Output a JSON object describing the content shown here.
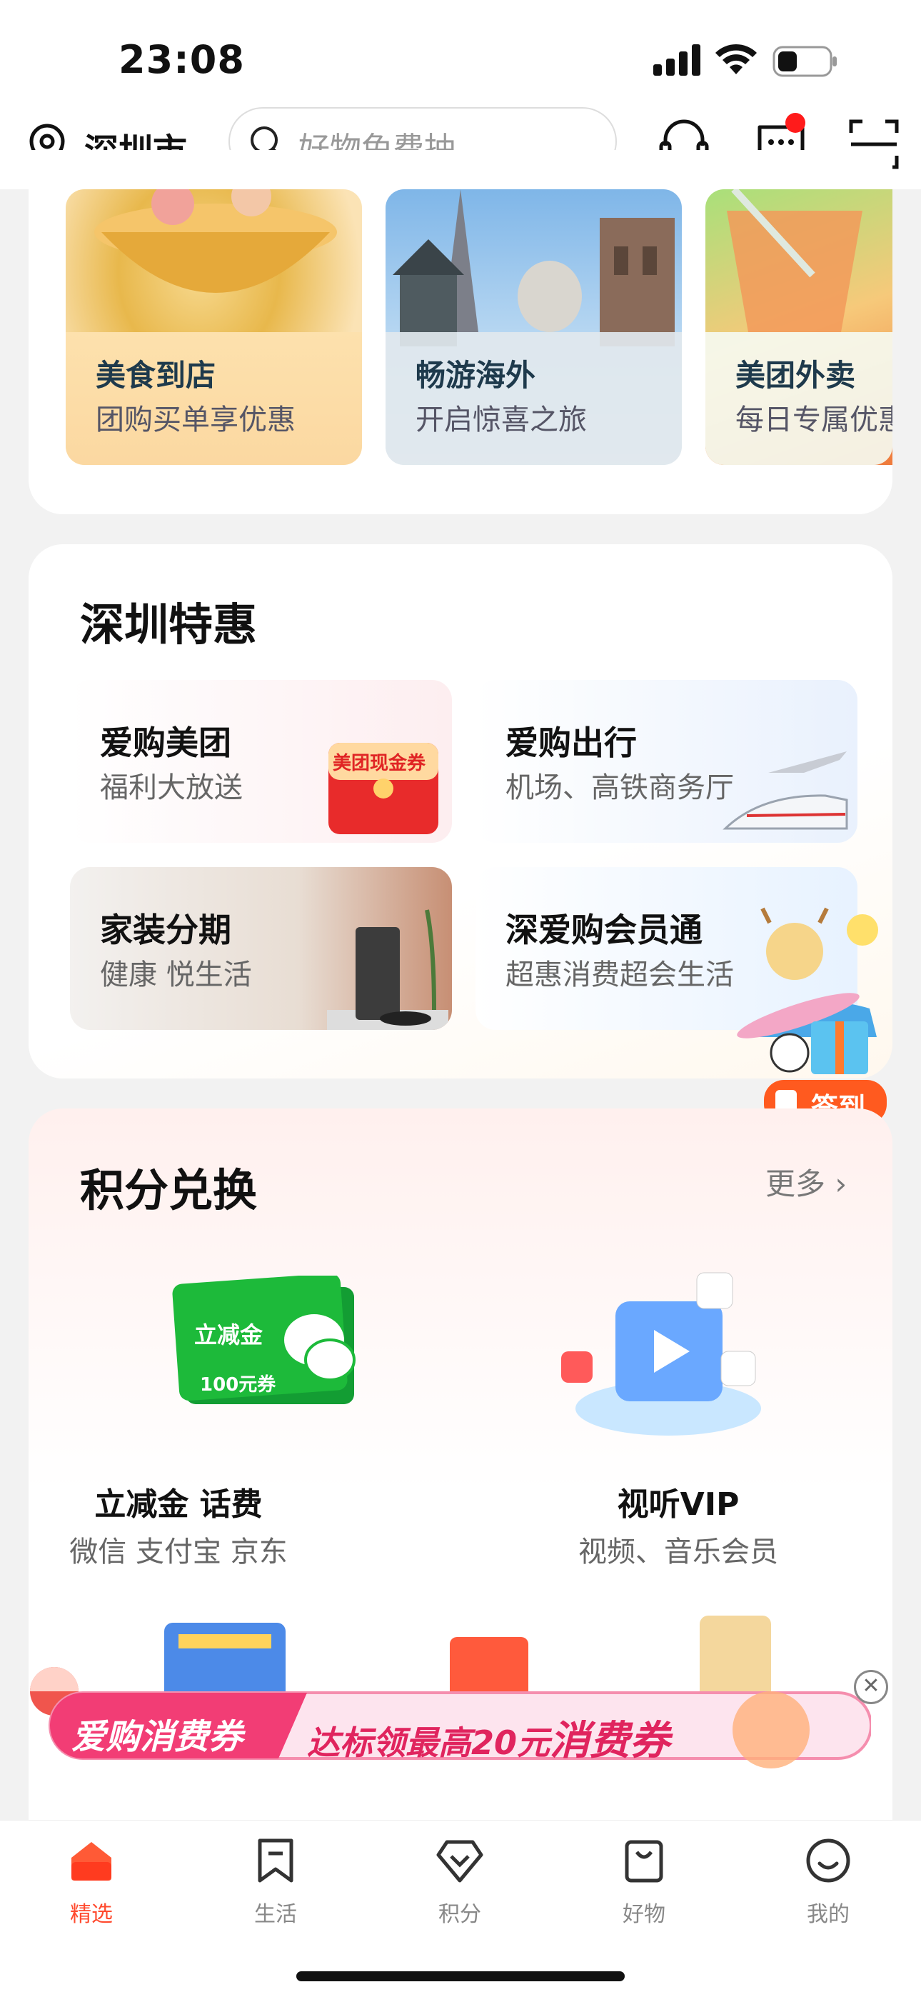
{
  "status_bar": {
    "time": "23:08"
  },
  "header": {
    "city": "深圳市",
    "search_placeholder": "好物免费抽"
  },
  "banner_tiles": [
    {
      "title": "美食到店",
      "subtitle": "团购买单享优惠"
    },
    {
      "title": "畅游海外",
      "subtitle": "开启惊喜之旅"
    },
    {
      "title": "美团外卖",
      "subtitle": "每日专属优惠"
    }
  ],
  "shenzhen_deals": {
    "title": "深圳特惠",
    "items": [
      {
        "title": "爱购美团",
        "subtitle": "福利大放送",
        "badge": "美团现金券"
      },
      {
        "title": "爱购出行",
        "subtitle": "机场、高铁商务厅"
      },
      {
        "title": "家装分期",
        "subtitle": "健康 悦生活"
      },
      {
        "title": "深爱购会员通",
        "subtitle": "超惠消费超会生活"
      }
    ]
  },
  "points_exchange": {
    "title": "积分兑换",
    "more": "更多",
    "items": [
      {
        "name": "立减金 话费",
        "sub": "微信 支付宝 京东",
        "card_text": "立减金",
        "card_amount": "100元券"
      },
      {
        "name": "视听VIP",
        "sub": "视频、音乐会员"
      }
    ]
  },
  "floating": {
    "signin": "签到",
    "promo_left": "爱购消费券",
    "promo_right_prefix": "达标领最高20元",
    "promo_right_suffix": "消费券"
  },
  "tabbar": [
    {
      "label": "精选",
      "active": true
    },
    {
      "label": "生活",
      "active": false
    },
    {
      "label": "积分",
      "active": false
    },
    {
      "label": "好物",
      "active": false
    },
    {
      "label": "我的",
      "active": false
    }
  ],
  "colors": {
    "accent": "#ff4a2e",
    "brand_green": "#1dba3a"
  }
}
